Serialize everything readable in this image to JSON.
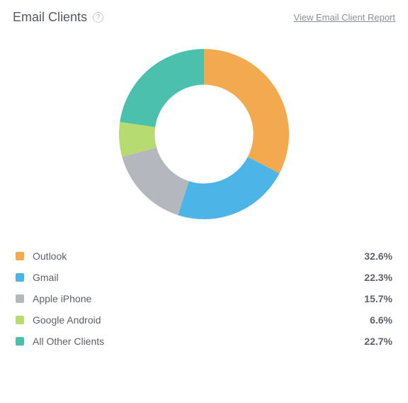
{
  "header": {
    "title": "Email Clients",
    "report_link": "View Email Client Report"
  },
  "chart_data": {
    "type": "pie",
    "title": "Email Clients",
    "series": [
      {
        "name": "Outlook",
        "value": 32.6,
        "color": "#f3a94e"
      },
      {
        "name": "Gmail",
        "value": 22.3,
        "color": "#4db5e5"
      },
      {
        "name": "Apple iPhone",
        "value": 15.7,
        "color": "#b3b8be"
      },
      {
        "name": "Google Android",
        "value": 6.6,
        "color": "#b6db6f"
      },
      {
        "name": "All Other Clients",
        "value": 22.7,
        "color": "#4bc0ad"
      }
    ],
    "value_suffix": "%",
    "inner_radius_ratio": 0.58
  }
}
